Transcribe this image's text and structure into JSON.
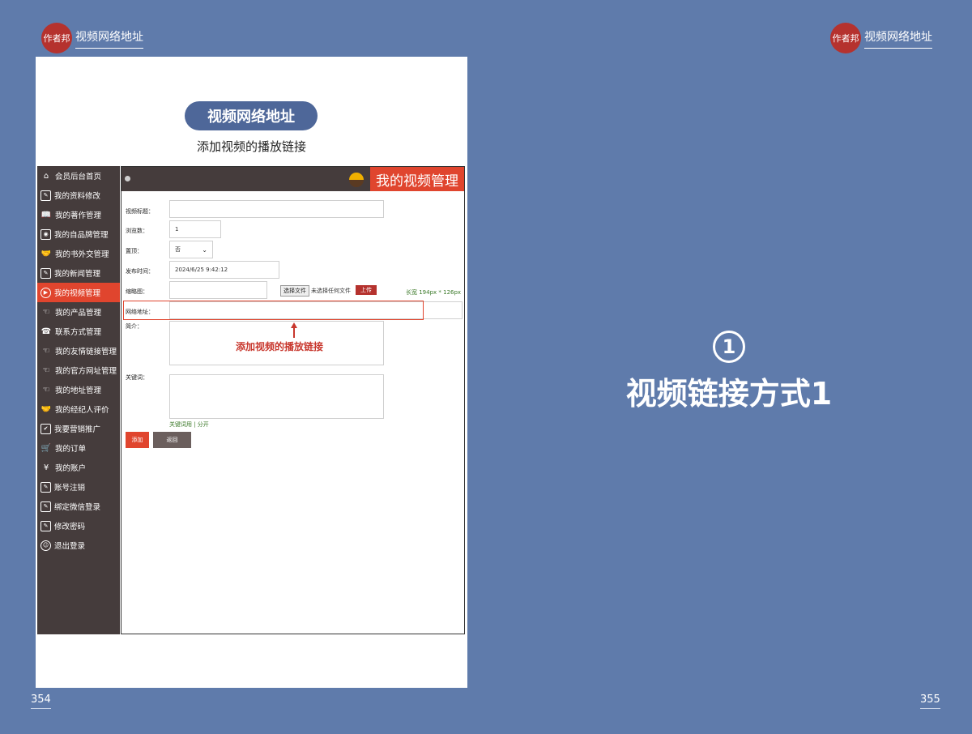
{
  "header": {
    "logo_text": "作者邦",
    "title": "视频网络地址"
  },
  "page_numbers": {
    "left": "354",
    "right": "355"
  },
  "panel": {
    "pill_title": "视频网络地址",
    "subtitle": "添加视频的播放链接"
  },
  "sidebar": {
    "items": [
      {
        "label": "会员后台首页",
        "icon": "home-icon",
        "glyph": "⌂",
        "style": "plain"
      },
      {
        "label": "我的资料修改",
        "icon": "edit-doc-icon",
        "glyph": "✎",
        "style": "outline"
      },
      {
        "label": "我的著作管理",
        "icon": "book-icon",
        "glyph": "📖",
        "style": "plain"
      },
      {
        "label": "我的自品牌管理",
        "icon": "camera-icon",
        "glyph": "◉",
        "style": "outline"
      },
      {
        "label": "我的书外交管理",
        "icon": "handshake-icon",
        "glyph": "🤝",
        "style": "plain"
      },
      {
        "label": "我的新闻管理",
        "icon": "news-icon",
        "glyph": "✎",
        "style": "outline"
      },
      {
        "label": "我的视频管理",
        "icon": "play-icon",
        "glyph": "▶",
        "style": "circle",
        "active": true
      },
      {
        "label": "我的产品管理",
        "icon": "hand-icon",
        "glyph": "☜",
        "style": "plain"
      },
      {
        "label": "联系方式管理",
        "icon": "phone-icon",
        "glyph": "☎",
        "style": "plain"
      },
      {
        "label": "我的友情链接管理",
        "icon": "hand-icon",
        "glyph": "☜",
        "style": "plain"
      },
      {
        "label": "我的官方网址管理",
        "icon": "hand-icon",
        "glyph": "☜",
        "style": "plain"
      },
      {
        "label": "我的地址管理",
        "icon": "hand-icon",
        "glyph": "☜",
        "style": "plain"
      },
      {
        "label": "我的经纪人评价",
        "icon": "handshake-icon",
        "glyph": "🤝",
        "style": "plain"
      },
      {
        "label": "我要营销推广",
        "icon": "checkbox-icon",
        "glyph": "✔",
        "style": "outline"
      },
      {
        "label": "我的订单",
        "icon": "cart-icon",
        "glyph": "🛒",
        "style": "plain"
      },
      {
        "label": "我的账户",
        "icon": "yen-icon",
        "glyph": "¥",
        "style": "plain"
      },
      {
        "label": "账号注销",
        "icon": "edit-doc-icon",
        "glyph": "✎",
        "style": "outline"
      },
      {
        "label": "绑定微信登录",
        "icon": "edit-doc-icon",
        "glyph": "✎",
        "style": "outline"
      },
      {
        "label": "修改密码",
        "icon": "edit-doc-icon",
        "glyph": "✎",
        "style": "outline"
      },
      {
        "label": "退出登录",
        "icon": "user-circle-icon",
        "glyph": "☺",
        "style": "circle"
      }
    ]
  },
  "topbar": {
    "tag": "我的视频管理"
  },
  "form": {
    "title_label": "视频标题：",
    "views_label": "浏览数：",
    "views_value": "1",
    "pin_label": "置顶：",
    "pin_value": "否",
    "time_label": "发布时间：",
    "time_value": "2024/6/25 9:42:12",
    "thumb_label": "缩略图：",
    "file_button": "选择文件",
    "file_status": "未选择任何文件",
    "upload_button": "上传",
    "size_hint": "长宽 194px * 126px",
    "url_label": "网络地址：",
    "intro_label": "简介：",
    "annotation": "添加视频的播放链接",
    "keywords_label": "关键词：",
    "keyword_links": "关键词用 | 分开",
    "add_button": "添加",
    "back_button": "返回"
  },
  "right": {
    "number": "1",
    "title": "视频链接方式1"
  },
  "colors": {
    "background": "#5f7bab",
    "accent": "#e0452e",
    "sidebar": "#453c3c",
    "pill": "#4e6799"
  }
}
